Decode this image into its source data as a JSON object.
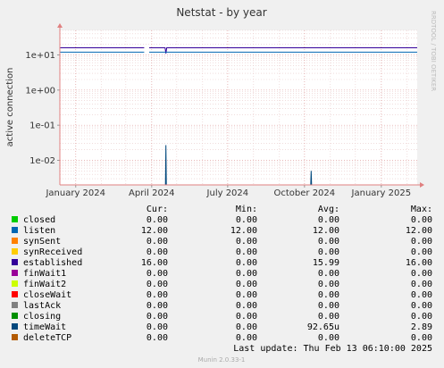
{
  "chart_data": {
    "type": "line",
    "title": "Netstat - by year",
    "ylabel": "active connection",
    "watermark": "RRDTOOL / TOBI OETIKER",
    "footer": "Munin 2.0.33-1",
    "y_scale": "log",
    "ylim": [
      0.002,
      50
    ],
    "y_ticks": [
      {
        "value": 10,
        "label": "1e+01"
      },
      {
        "value": 1,
        "label": "1e+00"
      },
      {
        "value": 0.1,
        "label": "1e-01"
      },
      {
        "value": 0.01,
        "label": "1e-02"
      }
    ],
    "x_range": [
      "2023-12-13",
      "2025-02-13"
    ],
    "x_ticks": [
      {
        "date": "2024-01-01",
        "label": "January 2024"
      },
      {
        "date": "2024-04-01",
        "label": "April 2024"
      },
      {
        "date": "2024-07-01",
        "label": "July 2024"
      },
      {
        "date": "2024-10-01",
        "label": "October 2024"
      },
      {
        "date": "2025-01-01",
        "label": "January 2025"
      }
    ],
    "grid": true,
    "gap": [
      "2024-03-23",
      "2024-03-29"
    ],
    "series": [
      {
        "name": "established",
        "color": "#330099",
        "points": [
          [
            "2023-12-13",
            16
          ],
          [
            "2024-03-23",
            16
          ],
          [
            "2024-03-29",
            16
          ],
          [
            "2024-04-17",
            16
          ],
          [
            "2024-04-18",
            11
          ],
          [
            "2024-04-19",
            16
          ],
          [
            "2025-02-13",
            16
          ]
        ]
      },
      {
        "name": "listen",
        "color": "#0066B3",
        "points": [
          [
            "2023-12-13",
            12
          ],
          [
            "2024-03-23",
            12
          ],
          [
            "2024-03-29",
            12
          ],
          [
            "2025-02-13",
            12
          ]
        ]
      },
      {
        "name": "timeWait",
        "color": "#00487D",
        "spikes": [
          [
            "2024-04-18",
            0.027
          ],
          [
            "2024-10-09",
            0.005
          ]
        ]
      }
    ]
  },
  "legend": {
    "headers": {
      "cur": "Cur:",
      "min": "Min:",
      "avg": "Avg:",
      "max": "Max:"
    },
    "rows": [
      {
        "name": "closed",
        "color": "#00CC00",
        "cur": "0.00",
        "min": "0.00",
        "avg": "0.00",
        "max": "0.00"
      },
      {
        "name": "listen",
        "color": "#0066B3",
        "cur": "12.00",
        "min": "12.00",
        "avg": "12.00",
        "max": "12.00"
      },
      {
        "name": "synSent",
        "color": "#FF8000",
        "cur": "0.00",
        "min": "0.00",
        "avg": "0.00",
        "max": "0.00"
      },
      {
        "name": "synReceived",
        "color": "#FFCC00",
        "cur": "0.00",
        "min": "0.00",
        "avg": "0.00",
        "max": "0.00"
      },
      {
        "name": "established",
        "color": "#330099",
        "cur": "16.00",
        "min": "0.00",
        "avg": "15.99",
        "max": "16.00"
      },
      {
        "name": "finWait1",
        "color": "#990099",
        "cur": "0.00",
        "min": "0.00",
        "avg": "0.00",
        "max": "0.00"
      },
      {
        "name": "finWait2",
        "color": "#CCFF00",
        "cur": "0.00",
        "min": "0.00",
        "avg": "0.00",
        "max": "0.00"
      },
      {
        "name": "closeWait",
        "color": "#FF0000",
        "cur": "0.00",
        "min": "0.00",
        "avg": "0.00",
        "max": "0.00"
      },
      {
        "name": "lastAck",
        "color": "#808080",
        "cur": "0.00",
        "min": "0.00",
        "avg": "0.00",
        "max": "0.00"
      },
      {
        "name": "closing",
        "color": "#008F00",
        "cur": "0.00",
        "min": "0.00",
        "avg": "0.00",
        "max": "0.00"
      },
      {
        "name": "timeWait",
        "color": "#00487D",
        "cur": "0.00",
        "min": "0.00",
        "avg": "92.65u",
        "max": "2.89"
      },
      {
        "name": "deleteTCP",
        "color": "#B35A00",
        "cur": "0.00",
        "min": "0.00",
        "avg": "0.00",
        "max": "0.00"
      }
    ],
    "last_update": "Last update:  Thu Feb 13 06:10:00 2025"
  }
}
